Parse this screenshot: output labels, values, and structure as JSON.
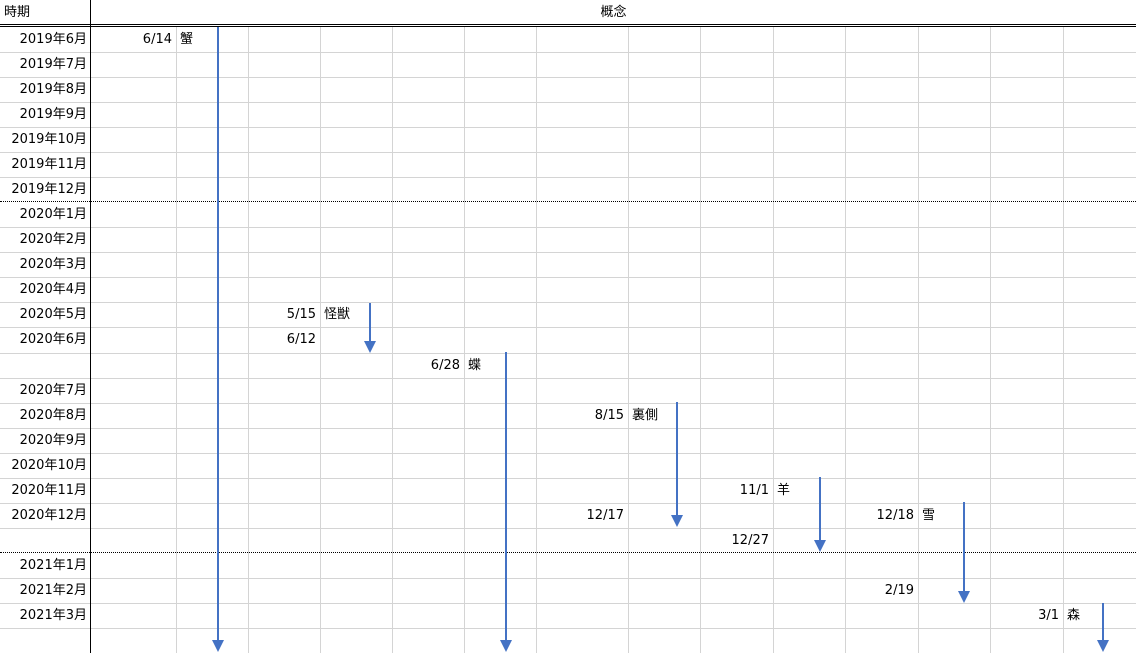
{
  "header": {
    "period_label": "時期",
    "concept_label": "概念"
  },
  "rows": [
    "2019年6月",
    "2019年7月",
    "2019年8月",
    "2019年9月",
    "2019年10月",
    "2019年11月",
    "2019年12月",
    "2020年1月",
    "2020年2月",
    "2020年3月",
    "2020年4月",
    "2020年5月",
    "2020年6月",
    "",
    "2020年7月",
    "2020年8月",
    "2020年9月",
    "2020年10月",
    "2020年11月",
    "2020年12月",
    "",
    "2021年1月",
    "2021年2月",
    "2021年3月",
    ""
  ],
  "events": [
    {
      "start": "6/14",
      "name": "蟹",
      "end": ""
    },
    {
      "start": "5/15",
      "name": "怪獣",
      "end": "6/12"
    },
    {
      "start": "6/28",
      "name": "蝶",
      "end": ""
    },
    {
      "start": "8/15",
      "name": "裏側",
      "end": "12/17"
    },
    {
      "start": "11/1",
      "name": "羊",
      "end": "12/27"
    },
    {
      "start": "12/18",
      "name": "雪",
      "end": "2/19"
    },
    {
      "start": "3/1",
      "name": "森",
      "end": ""
    }
  ],
  "colors": {
    "arrow": "#4472c4",
    "grid": "#d4d4d4"
  }
}
